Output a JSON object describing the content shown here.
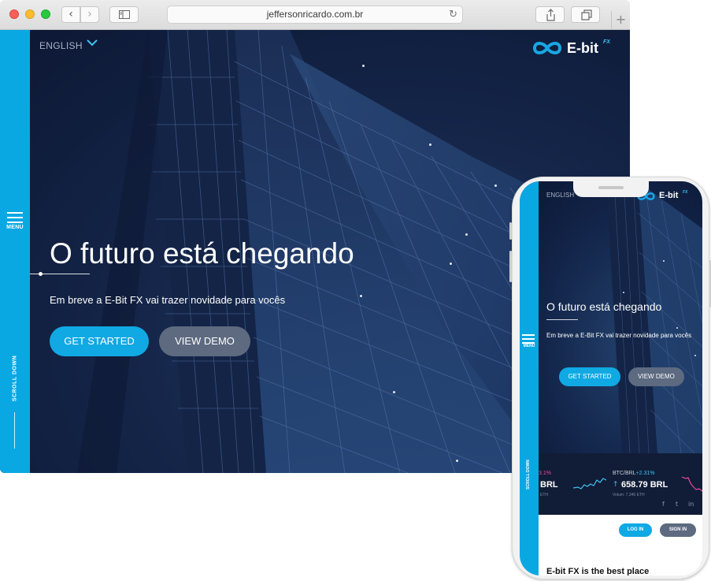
{
  "browser": {
    "url": "jeffersonricardo.com.br",
    "back_icon": "chevron-left-icon",
    "forward_icon": "chevron-right-icon",
    "reload_icon": "reload-icon"
  },
  "site": {
    "language": "ENGLISH",
    "logo": {
      "text": "E-bit",
      "superscript": "FX"
    },
    "sidebar": {
      "menu_label": "MENU",
      "scroll_label": "SCROLL DOWN"
    },
    "hero": {
      "title": "O futuro está chegando",
      "subtitle": "Em breve a E-Bit FX vai trazer novidade para vocês",
      "primary_button": "GET STARTED",
      "secondary_button": "VIEW DEMO"
    },
    "colors": {
      "accent": "#0aa8e3",
      "secondary_button": "#5d6a80",
      "background": "#13254a"
    }
  },
  "mobile": {
    "language": "ENGLISH",
    "logo": {
      "text": "E-bit",
      "superscript": "FX"
    },
    "menu_label": "MENU",
    "scroll_label": "SCROLL DOWN",
    "title": "O futuro está chegando",
    "subtitle": "Em breve a E-Bit FX vai trazer novidade para vocês",
    "primary_button": "GET STARTED",
    "secondary_button": "VIEW DEMO",
    "ticker": {
      "item1": {
        "change": "3.1%",
        "value": "BRL",
        "volume": "ETH"
      },
      "item2": {
        "pair": "BTC/BRL",
        "change": "+2.31%",
        "arrow": "↑",
        "value": "658.79 BRL",
        "volume": "Volum: 7,346 ETH"
      }
    },
    "social": {
      "facebook": "f",
      "twitter": "t",
      "linkedin": "in"
    },
    "login_button": "LOG IN",
    "signin_button": "SIGN IN",
    "bottom_text": "E-bit FX is the best place"
  }
}
